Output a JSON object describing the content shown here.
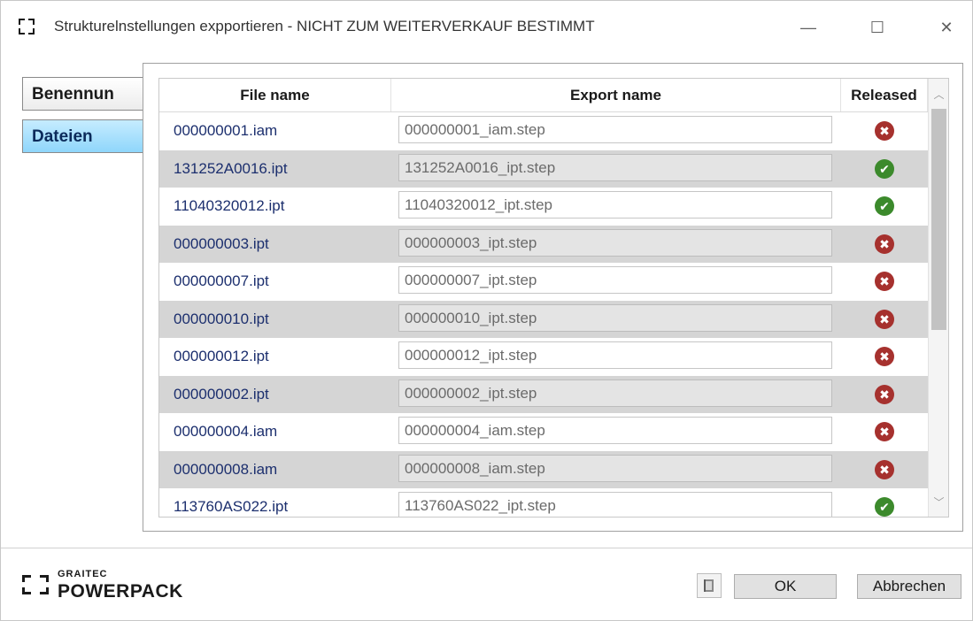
{
  "window": {
    "title": "Strukturelnstellungen expportieren - NICHT ZUM WEITERVERKAUF BESTIMMT",
    "controls": {
      "minimize": "—",
      "maximize": "☐",
      "close": "✕"
    }
  },
  "sidebar": {
    "tabs": [
      {
        "label": "Benennun"
      },
      {
        "label": "Dateien",
        "selected": true
      }
    ]
  },
  "grid": {
    "columns": {
      "file_name": "File name",
      "export_name": "Export name",
      "released": "Released"
    },
    "rows": [
      {
        "file_name": "000000001.iam",
        "export_name": "000000001_iam.step",
        "released": false
      },
      {
        "file_name": "131252A0016.ipt",
        "export_name": "131252A0016_ipt.step",
        "released": true
      },
      {
        "file_name": "11040320012.ipt",
        "export_name": "11040320012_ipt.step",
        "released": true
      },
      {
        "file_name": "000000003.ipt",
        "export_name": "000000003_ipt.step",
        "released": false
      },
      {
        "file_name": "000000007.ipt",
        "export_name": "000000007_ipt.step",
        "released": false
      },
      {
        "file_name": "000000010.ipt",
        "export_name": "000000010_ipt.step",
        "released": false
      },
      {
        "file_name": "000000012.ipt",
        "export_name": "000000012_ipt.step",
        "released": false
      },
      {
        "file_name": "000000002.ipt",
        "export_name": "000000002_ipt.step",
        "released": false
      },
      {
        "file_name": "000000004.iam",
        "export_name": "000000004_iam.step",
        "released": false
      },
      {
        "file_name": "000000008.iam",
        "export_name": "000000008_iam.step",
        "released": false
      },
      {
        "file_name": "113760AS022.ipt",
        "export_name": "113760AS022_ipt.step",
        "released": true
      }
    ],
    "status_icons": {
      "yes": "✔",
      "no": "✖"
    },
    "scroll": {
      "up": "︿",
      "down": "﹀"
    }
  },
  "footer": {
    "logo_small": "GRAITEC",
    "logo_big": "POWERPACK",
    "ok_label": "OK",
    "cancel_label": "Abbrechen"
  },
  "colors": {
    "accent_tab": "#8fd6fb",
    "released_yes": "#3c8a2c",
    "released_no": "#a6312e",
    "file_text": "#1c2f6e"
  }
}
